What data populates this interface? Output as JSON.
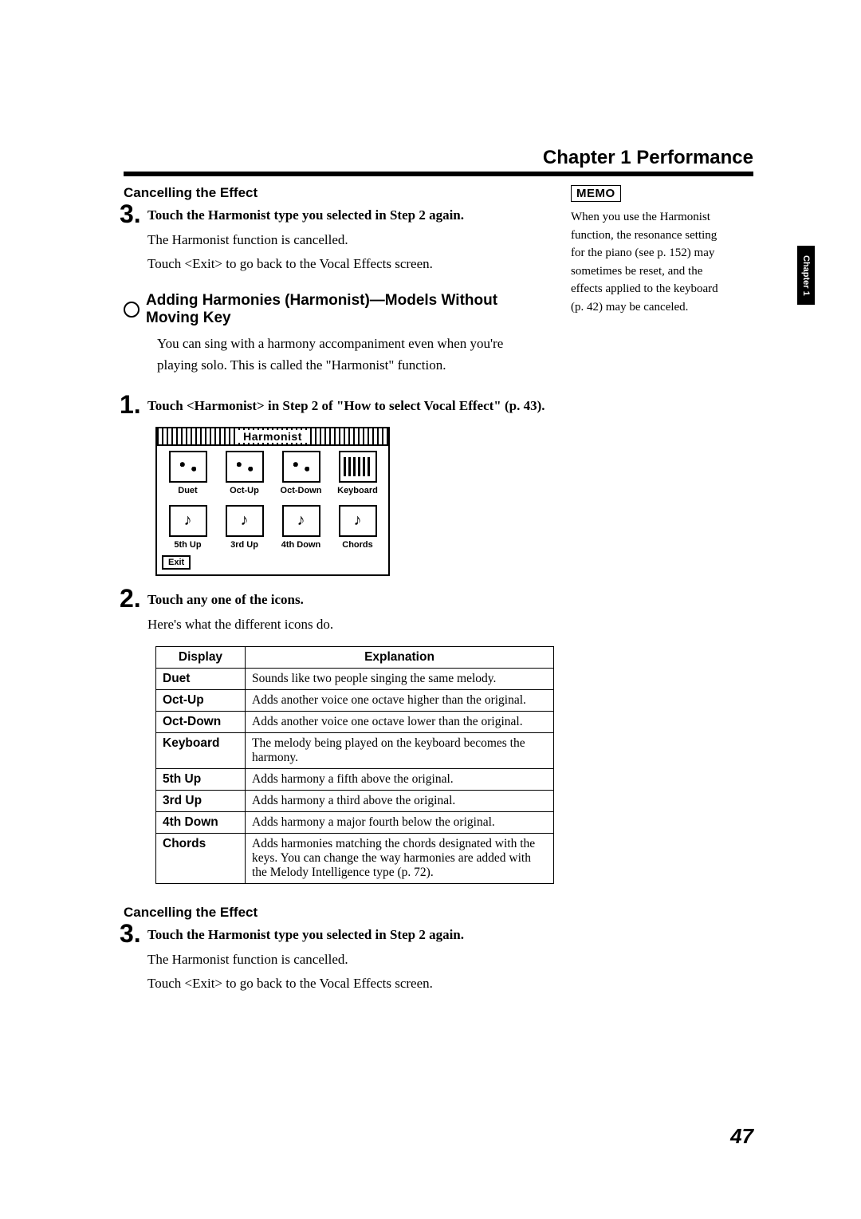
{
  "chapter_title": "Chapter 1 Performance",
  "side_tab": "Chapter 1",
  "page_number": "47",
  "memo": {
    "label": "MEMO",
    "text": "When you use the Harmonist function, the resonance setting for the piano (see p. 152) may sometimes be reset, and the effects applied to the keyboard (p. 42) may be canceled."
  },
  "cancel1": {
    "heading": "Cancelling the Effect",
    "step_num": "3.",
    "step_bold": "Touch the Harmonist type you selected in Step 2 again.",
    "line1": "The Harmonist function is cancelled.",
    "line2": "Touch <Exit> to go back to the Vocal Effects screen."
  },
  "section2": {
    "title": "Adding Harmonies (Harmonist)—Models Without Moving Key",
    "intro": "You can sing with a harmony accompaniment even when you're playing solo. This is called the \"Harmonist\" function."
  },
  "step_1": {
    "num": "1.",
    "bold": "Touch <Harmonist> in Step 2 of \"How to select Vocal Effect\" (p. 43)."
  },
  "lcd": {
    "title": "Harmonist",
    "row1": [
      "Duet",
      "Oct-Up",
      "Oct-Down",
      "Keyboard"
    ],
    "row2": [
      "5th Up",
      "3rd Up",
      "4th Down",
      "Chords"
    ],
    "exit": "Exit"
  },
  "step_2": {
    "num": "2.",
    "bold": "Touch any one of the icons.",
    "body": "Here's what the different icons do."
  },
  "table": {
    "head_display": "Display",
    "head_explanation": "Explanation",
    "rows": [
      {
        "d": "Duet",
        "e": "Sounds like two people singing the same melody."
      },
      {
        "d": "Oct-Up",
        "e": "Adds another voice one octave higher than the original."
      },
      {
        "d": "Oct-Down",
        "e": "Adds another voice one octave lower than the original."
      },
      {
        "d": "Keyboard",
        "e": "The melody being played on the keyboard becomes the harmony."
      },
      {
        "d": "5th Up",
        "e": "Adds harmony a fifth above the original."
      },
      {
        "d": "3rd Up",
        "e": "Adds harmony a third above the original."
      },
      {
        "d": "4th Down",
        "e": "Adds harmony a major fourth below the original."
      },
      {
        "d": "Chords",
        "e": "Adds harmonies matching the chords designated with the keys. You can change the way harmonies are added with the Melody Intelligence type (p. 72)."
      }
    ]
  },
  "cancel2": {
    "heading": "Cancelling the Effect",
    "step_num": "3.",
    "step_bold": "Touch the Harmonist type you selected in Step 2 again.",
    "line1": "The Harmonist function is cancelled.",
    "line2": "Touch <Exit> to go back to the Vocal Effects screen."
  }
}
